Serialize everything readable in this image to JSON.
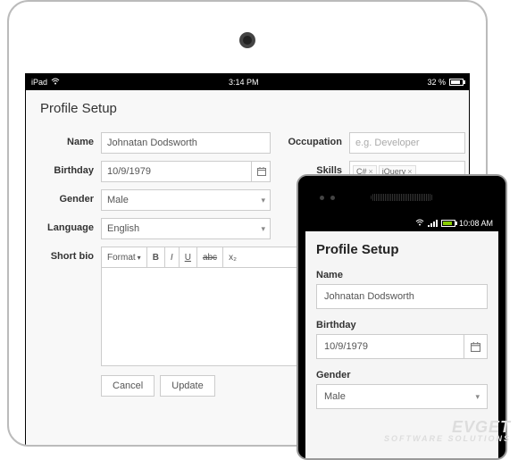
{
  "ipad": {
    "statusbar": {
      "device": "iPad",
      "time": "3:14 PM",
      "battery": "32 %"
    },
    "title": "Profile Setup",
    "labels": {
      "name": "Name",
      "birthday": "Birthday",
      "gender": "Gender",
      "language": "Language",
      "shortbio": "Short bio",
      "occupation": "Occupation",
      "skills": "Skills"
    },
    "values": {
      "name": "Johnatan Dodsworth",
      "birthday": "10/9/1979",
      "gender": "Male",
      "language": "English",
      "occupation_placeholder": "e.g. Developer",
      "skills": [
        "C#",
        "jQuery"
      ]
    },
    "toolbar": {
      "format": "Format",
      "bold": "B",
      "italic": "I",
      "underline": "U",
      "strike": "abc",
      "sub": "x₂"
    },
    "buttons": {
      "cancel": "Cancel",
      "update": "Update"
    }
  },
  "phone": {
    "statusbar": {
      "time": "10:08 AM"
    },
    "title": "Profile Setup",
    "labels": {
      "name": "Name",
      "birthday": "Birthday",
      "gender": "Gender"
    },
    "values": {
      "name": "Johnatan Dodsworth",
      "birthday": "10/9/1979",
      "gender": "Male"
    }
  },
  "watermark": {
    "brand": "EVGET",
    "tag": "SOFTWARE SOLUTIONS"
  }
}
